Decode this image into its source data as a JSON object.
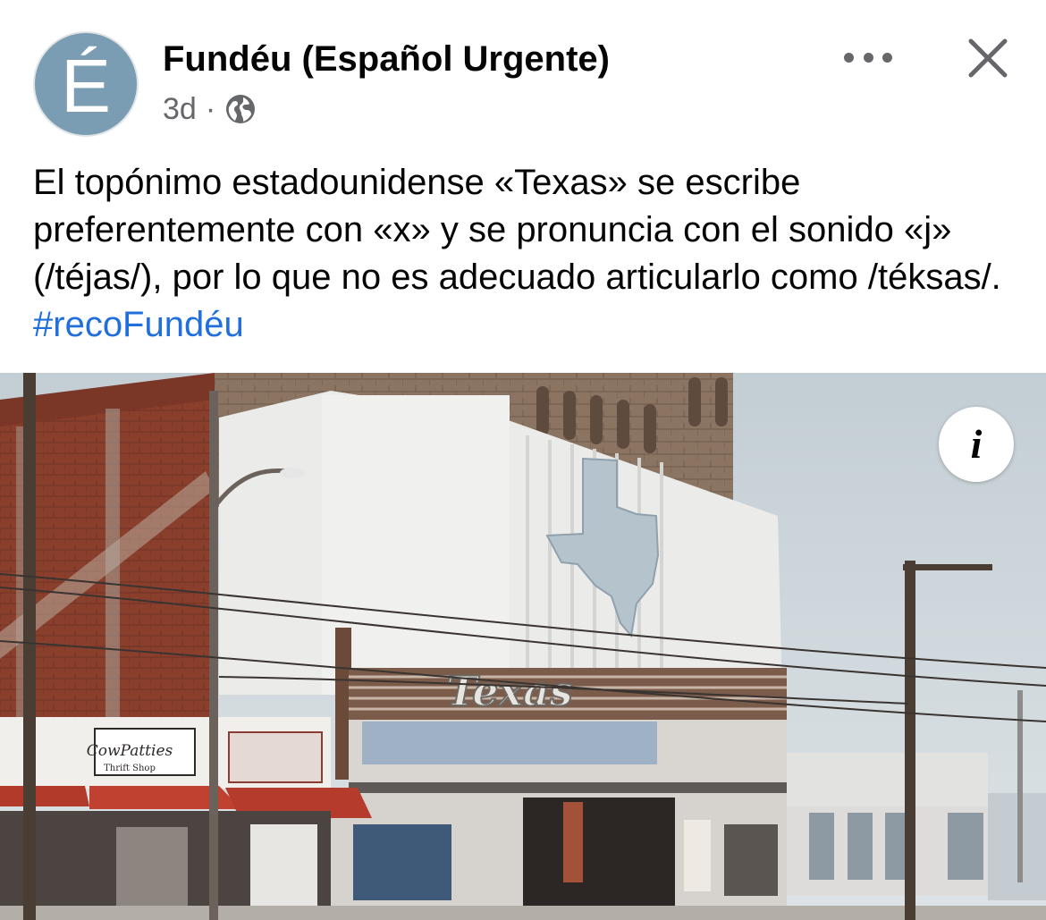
{
  "post": {
    "author": "Fundéu (Español Urgente)",
    "avatar_letter": "É",
    "time": "3d",
    "separator": "·",
    "audience_icon": "globe-icon",
    "more_icon": "more-options-icon",
    "close_icon": "close-icon",
    "text": "El topónimo estadounidense «Texas» se escribe preferentemente con «x» y se pronuncia con el sonido «j» (/téjas/), por lo que no es adecuado articularlo como /téksas/.",
    "hashtag": "#recoFundéu"
  },
  "photo": {
    "marquee_text": "Texas",
    "shop_sign": "CowPatties",
    "shop_sign_sub": "Thrift Shop",
    "info_label": "i"
  },
  "colors": {
    "avatar_bg": "#7a9db3",
    "hashtag": "#216fdb",
    "secondary_text": "#65676b"
  }
}
